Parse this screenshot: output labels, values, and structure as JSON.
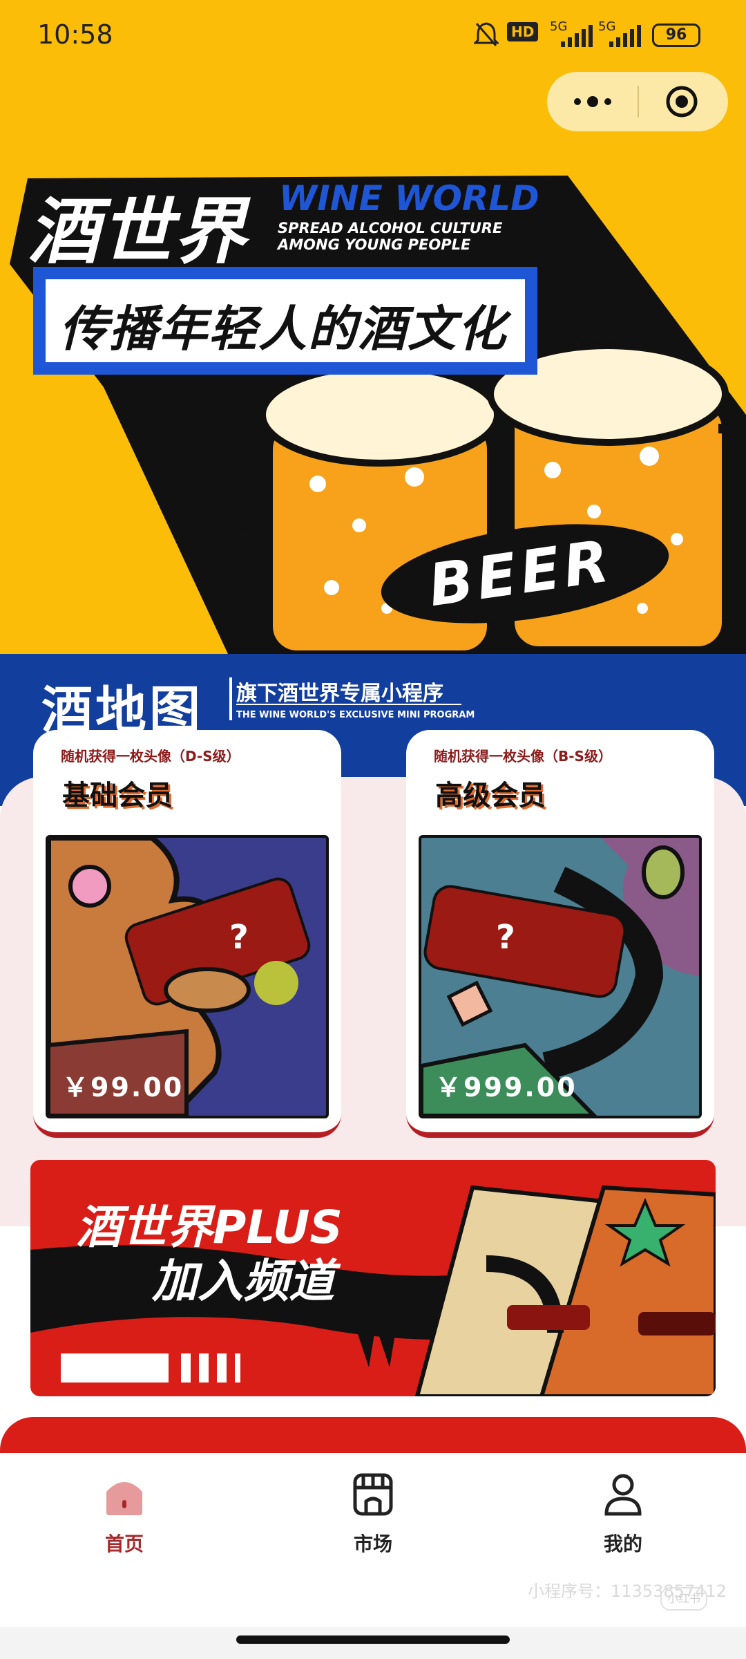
{
  "status_bar": {
    "time": "10:58",
    "signal1": "5G",
    "signal2": "5G",
    "battery": "96",
    "hd_label": "HD"
  },
  "capsule": {
    "more_icon": "more-dots-icon",
    "close_icon": "target-icon"
  },
  "banner": {
    "title_cn": "酒世界",
    "title_en": "WINE WORLD",
    "tagline_line1": "SPREAD ALCOHOL CULTURE",
    "tagline_line2": "AMONG YOUNG PEOPLE",
    "slogan": "传播年轻人的酒文化",
    "beer_label": "BEER"
  },
  "brand": {
    "logo": "酒地图",
    "subtitle": "旗下酒世界专属小程序",
    "subtitle_en": "THE WINE WORLD'S EXCLUSIVE MINI PROGRAM"
  },
  "members": [
    {
      "note": "随机获得一枚头像（D-S级）",
      "title": "基础会员",
      "price": "￥99.00",
      "mystery": "?"
    },
    {
      "note": "随机获得一枚头像（B-S级）",
      "title": "高级会员",
      "price": "￥999.00",
      "mystery": "?"
    }
  ],
  "plus_banner": {
    "line1": "酒世界PLUS",
    "line2": "加入频道"
  },
  "tabs": [
    {
      "label": "首页",
      "icon": "home-icon",
      "active": true
    },
    {
      "label": "市场",
      "icon": "store-icon",
      "active": false
    },
    {
      "label": "我的",
      "icon": "user-icon",
      "active": false
    }
  ],
  "watermark": {
    "text": "小程序号：11353857412",
    "logo": "小红书"
  },
  "colors": {
    "yellow": "#FBBD08",
    "blue": "#123E9E",
    "red": "#D81E17",
    "accent_tab": "#A7282A"
  }
}
